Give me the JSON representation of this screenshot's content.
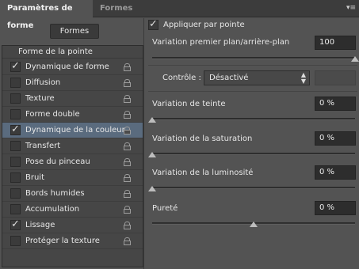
{
  "tabs": [
    {
      "label": "Paramètres de forme",
      "active": true
    },
    {
      "label": "Formes",
      "active": false
    }
  ],
  "panel_menu_icon": "panel-menu-icon",
  "formes_button": "Formes",
  "brush_list": {
    "header": "Forme de la pointe",
    "items": [
      {
        "label": "Dynamique de forme",
        "checked": true,
        "selected": false
      },
      {
        "label": "Diffusion",
        "checked": false,
        "selected": false
      },
      {
        "label": "Texture",
        "checked": false,
        "selected": false
      },
      {
        "label": "Forme double",
        "checked": false,
        "selected": false
      },
      {
        "label": "Dynamique de la couleur",
        "checked": true,
        "selected": true
      },
      {
        "label": "Transfert",
        "checked": false,
        "selected": false
      },
      {
        "label": "Pose du pinceau",
        "checked": false,
        "selected": false
      },
      {
        "label": "Bruit",
        "checked": false,
        "selected": false
      },
      {
        "label": "Bords humides",
        "checked": false,
        "selected": false
      },
      {
        "label": "Accumulation",
        "checked": false,
        "selected": false
      },
      {
        "label": "Lissage",
        "checked": true,
        "selected": false
      },
      {
        "label": "Protéger la texture",
        "checked": false,
        "selected": false
      }
    ]
  },
  "settings": {
    "apply_per_tip": {
      "label": "Appliquer par pointe",
      "checked": true
    },
    "foreground_background": {
      "label": "Variation premier plan/arrière-plan",
      "value": "100",
      "level": 1.0
    },
    "control": {
      "label": "Contrôle :",
      "value": "Désactivé"
    },
    "hue": {
      "label": "Variation de teinte",
      "value": "0 %",
      "level": 0.0
    },
    "saturation": {
      "label": "Variation de la saturation",
      "value": "0 %",
      "level": 0.0
    },
    "brightness": {
      "label": "Variation de la luminosité",
      "value": "0 %",
      "level": 0.0
    },
    "purity": {
      "label": "Pureté",
      "value": "0 %",
      "level": 0.5
    }
  },
  "colors": {
    "selected_row": "#5a6b7e",
    "panel_bg": "#535353"
  }
}
